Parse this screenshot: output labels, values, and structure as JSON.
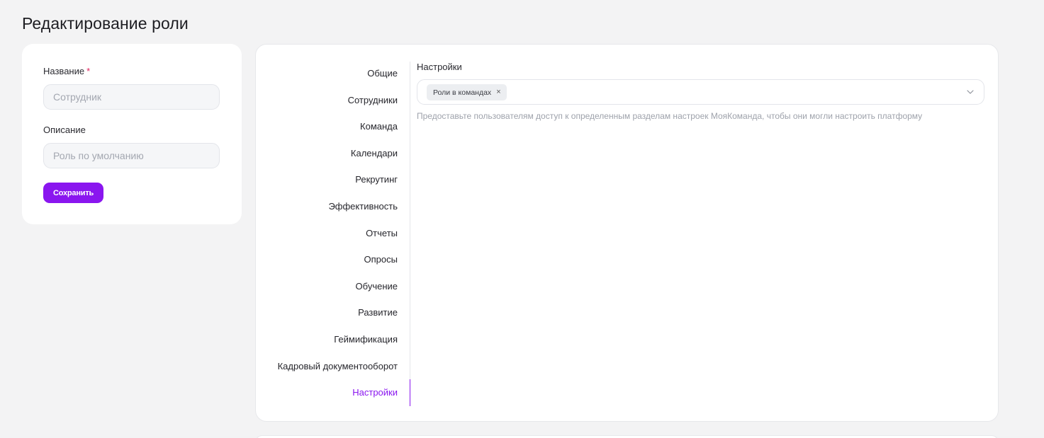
{
  "page_title": "Редактирование роли",
  "form": {
    "name_label": "Название",
    "required_mark": "*",
    "name_placeholder": "Сотрудник",
    "description_label": "Описание",
    "description_placeholder": "Роль по умолчанию",
    "save_label": "Сохранить"
  },
  "tabs": [
    {
      "label": "Общие"
    },
    {
      "label": "Сотрудники"
    },
    {
      "label": "Команда"
    },
    {
      "label": "Календари"
    },
    {
      "label": "Рекрутинг"
    },
    {
      "label": "Эффективность"
    },
    {
      "label": "Отчеты"
    },
    {
      "label": "Опросы"
    },
    {
      "label": "Обучение"
    },
    {
      "label": "Развитие"
    },
    {
      "label": "Геймификация"
    },
    {
      "label": "Кадровый документооборот"
    },
    {
      "label": "Настройки"
    }
  ],
  "active_tab": "Настройки",
  "settings": {
    "section_title": "Настройки",
    "selected_chip": "Роли в командах",
    "chip_remove_icon": "close-icon",
    "dropdown_icon": "chevron-down-icon",
    "helper_text": "Предоставьте пользователям доступ к определенным разделам настроек МояКоманда, чтобы они могли настроить платформу"
  },
  "colors": {
    "accent": "#8a16ef",
    "background": "#f3f3f4",
    "required": "#e0245e"
  }
}
